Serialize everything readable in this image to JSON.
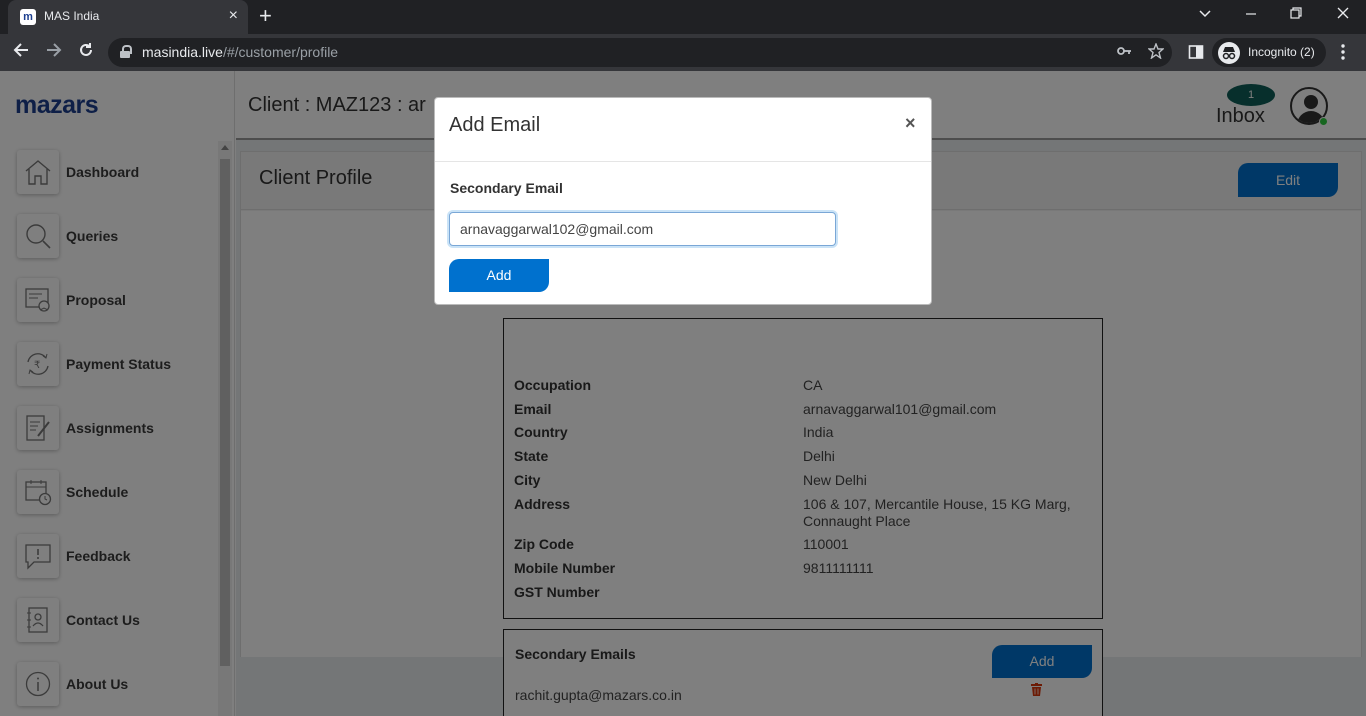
{
  "browser": {
    "tab_title": "MAS India",
    "tab_favicon_letter": "m",
    "tab_close": "×",
    "new_tab": "+",
    "url_host": "masindia.live",
    "url_path": "/#/customer/profile",
    "incognito_label": "Incognito (2)"
  },
  "sidebar": {
    "logo": "mazars",
    "items": [
      {
        "label": "Dashboard",
        "icon": "home-icon"
      },
      {
        "label": "Queries",
        "icon": "search-icon"
      },
      {
        "label": "Proposal",
        "icon": "proposal-icon"
      },
      {
        "label": "Payment Status",
        "icon": "rupee-cycle-icon"
      },
      {
        "label": "Assignments",
        "icon": "assignment-icon"
      },
      {
        "label": "Schedule",
        "icon": "calendar-clock-icon"
      },
      {
        "label": "Feedback",
        "icon": "feedback-icon"
      },
      {
        "label": "Contact Us",
        "icon": "contact-book-icon"
      },
      {
        "label": "About Us",
        "icon": "info-icon"
      }
    ]
  },
  "header": {
    "client_title": "Client : MAZ123 : ar",
    "inbox_label": "Inbox",
    "inbox_count": "1"
  },
  "profile": {
    "title": "Client Profile",
    "edit_label": "Edit",
    "details": [
      {
        "key": "Occupation",
        "value": "CA"
      },
      {
        "key": "Email",
        "value": "arnavaggarwal101@gmail.com"
      },
      {
        "key": "Country",
        "value": "India"
      },
      {
        "key": "State",
        "value": "Delhi"
      },
      {
        "key": "City",
        "value": "New Delhi"
      },
      {
        "key": "Address",
        "value": "106 & 107, Mercantile House, 15 KG Marg, Connaught Place"
      },
      {
        "key": "Zip Code",
        "value": "110001"
      },
      {
        "key": "Mobile Number",
        "value": "9811111111"
      },
      {
        "key": "GST Number",
        "value": ""
      }
    ],
    "secondary": {
      "title": "Secondary Emails",
      "add_label": "Add",
      "emails": [
        "rachit.gupta@mazars.co.in"
      ]
    }
  },
  "modal": {
    "title": "Add Email",
    "close": "×",
    "field_label": "Secondary Email",
    "field_value": "arnavaggarwal102@gmail.com",
    "add_label": "Add"
  },
  "colors": {
    "primary": "#0071ce",
    "brand": "#1d3f8f",
    "delete": "#d9360b",
    "badge": "#0f5f58"
  }
}
